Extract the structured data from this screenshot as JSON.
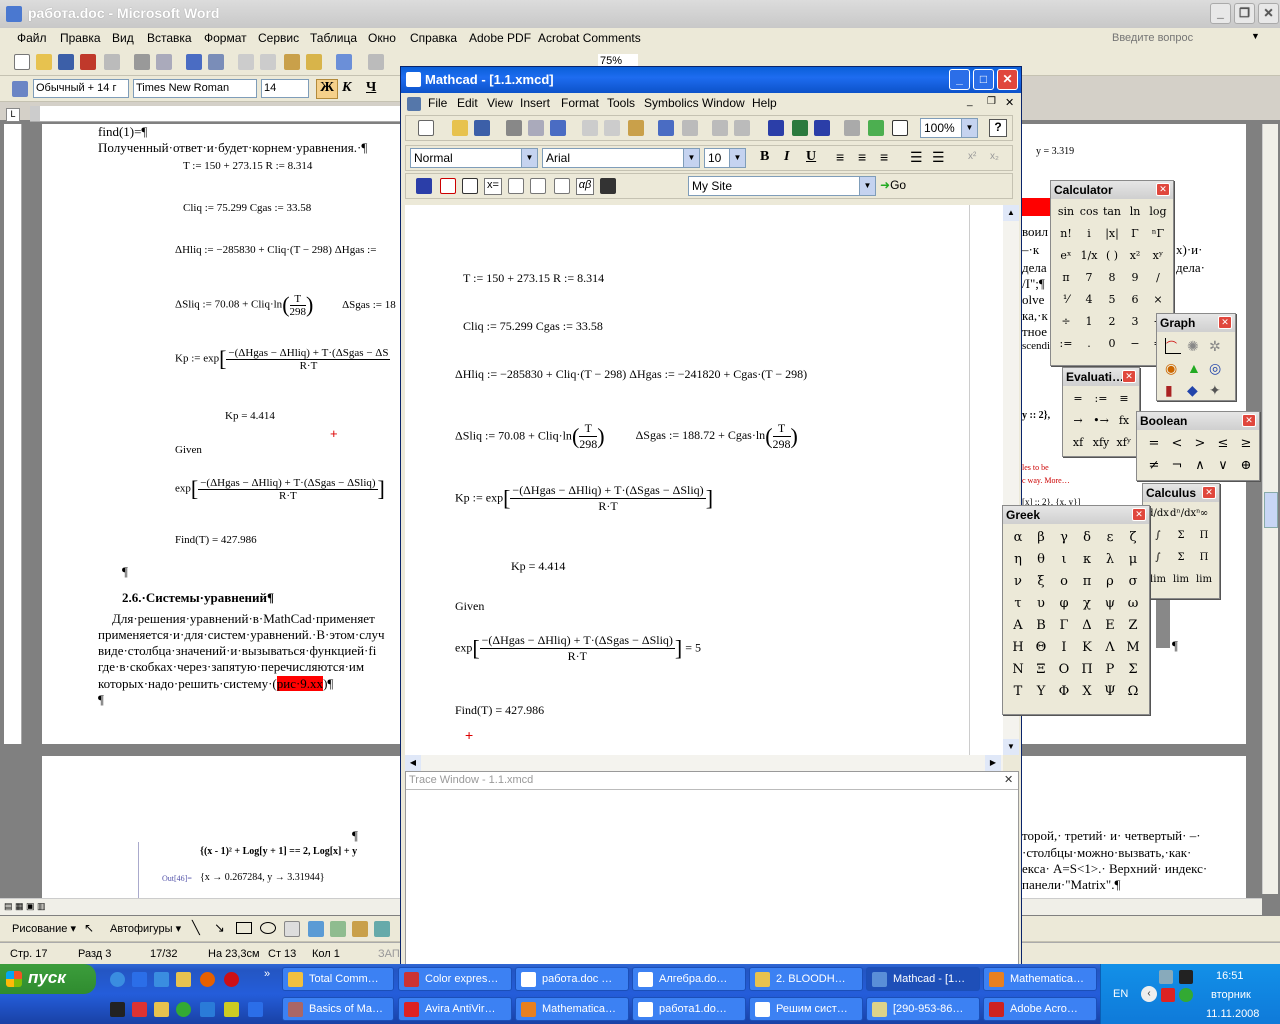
{
  "word": {
    "title": "работа.doc - Microsoft Word",
    "menu": [
      "Файл",
      "Правка",
      "Вид",
      "Вставка",
      "Формат",
      "Сервис",
      "Таблица",
      "Окно",
      "Справка",
      "Adobe PDF",
      "Acrobat Comments"
    ],
    "help_placeholder": "Введите вопрос",
    "style": "Обычный + 14 г",
    "font": "Times New Roman",
    "size": "14",
    "zoom": "75%",
    "bold": "Ж",
    "italic": "К",
    "underline": "Ч",
    "doc_lines": {
      "l1": "find(1)=¶",
      "l2": "Полученный·ответ·и·будет·корнем·уравнения.·¶",
      "heading": "2.6.·Системы·уравнений¶",
      "p1": "Для·решения·уравнений·в·MathCad·применяет",
      "p2": "применяется·и·для·систем·уравнений.·В·этом·случ",
      "p3": "виде·столбца·значений·и·вызываться·функцией·fi",
      "p4": "где·в·скобках·через·запятую·перечисляются·им",
      "p5a": "которых·надо·решить·систему·(",
      "p5b": "рис·9.xx",
      "p5c": ")¶",
      "pil": "¶"
    },
    "doc_eq": {
      "e1": "T := 150 + 273.15        R := 8.314",
      "e2": "Cliq := 75.299              Cgas := 33.58",
      "e3": "ΔHliq := −285830 + Cliq·(T − 298)       ΔHgas :=",
      "e4": "ΔSliq := 70.08 + Cliq·ln",
      "e4b": "ΔSgas := 18",
      "e5": "Kp := exp",
      "e5n": "−(ΔHgas − ΔHliq) + T·(ΔSgas − ΔS",
      "e5d": "R·T",
      "e6": "Kp = 4.414",
      "e7": "Given",
      "e8": "exp",
      "e8n": "−(ΔHgas − ΔHliq) + T·(ΔSgas − ΔSliq)",
      "e8d": "R·T",
      "e9": "Find(T) = 427.986",
      "frac_n": "T",
      "frac_d": "298"
    },
    "right_page": {
      "y_val": "y = 3.319",
      "r1": "воил",
      "r2": "–·к",
      "r3": "дела",
      "r4": "/I\";¶",
      "r5": "olve",
      "r6": "ка,·к",
      "r7": "тное",
      "r8": "scendi",
      "r9": "x)·и·",
      "r10": "дела·",
      "r11": "y :: 2},",
      "r12": "les to be",
      "r13": "c way. More…",
      "r14": "[x] :: 2}, {x, y}]",
      "r15": "¶"
    },
    "page2": {
      "pil": "¶",
      "eq": "{(x - 1)² + Log[y + 1] == 2, Log[x] + y",
      "out_label": "Out[46]=",
      "out": "{x → 0.267284, y → 3.31944}",
      "r1": "торой,· третий· и· четвертый· –·",
      "r2": "·столбцы·можно·вызвать,·как·",
      "r3": "екса· A=S<1>.· Верхний· индекс·",
      "r4": "панели·\"Matrix\".¶"
    },
    "draw_bar": {
      "draw": "Рисование ▾",
      "autoshapes": "Автофигуры ▾"
    },
    "status": {
      "page": "Стр. 17",
      "section": "Разд 3",
      "pages": "17/32",
      "at": "На 23,3см",
      "line": "Ст 13",
      "col": "Кол 1",
      "zap": "ЗАП"
    }
  },
  "mathcad": {
    "title": "Mathcad - [1.1.xmcd]",
    "menu": [
      "File",
      "Edit",
      "View",
      "Insert",
      "Format",
      "Tools",
      "Symbolics",
      "Window",
      "Help"
    ],
    "zoom": "100%",
    "style": "Normal",
    "font": "Arial",
    "size": "10",
    "site": "My Site",
    "go": "Go",
    "b": "B",
    "i": "I",
    "u": "U",
    "eq": {
      "e1": "T := 150 + 273.15        R := 8.314",
      "e2": "Cliq := 75.299                Cgas := 33.58",
      "e3": "ΔHliq := −285830 + Cliq·(T − 298)        ΔHgas := −241820 + Cgas·(T − 298)",
      "e4a": "ΔSliq := 70.08 + Cliq·ln",
      "e4b": "ΔSgas := 188.72 + Cgas·ln",
      "frac_n": "T",
      "frac_d": "298",
      "e5": "Kp := exp",
      "num": "−(ΔHgas − ΔHliq) + T·(ΔSgas − ΔSliq)",
      "den": "R·T",
      "e6": "Kp = 4.414",
      "e7": "Given",
      "e8": "exp",
      "e8r": "= 5",
      "e9": "Find(T) = 427.986"
    },
    "trace_title": "Trace Window - 1.1.xmcd"
  },
  "palettes": {
    "calculator": {
      "title": "Calculator",
      "keys": [
        "sin",
        "cos",
        "tan",
        "ln",
        "log",
        "n!",
        "i",
        "|x|",
        "Γ",
        "ⁿΓ",
        "eˣ",
        "1/x",
        "( )",
        "x²",
        "xʸ",
        "π",
        "7",
        "8",
        "9",
        "/",
        "⅟",
        "4",
        "5",
        "6",
        "×",
        "÷",
        "1",
        "2",
        "3",
        "+",
        ":=",
        ".",
        "0",
        "−",
        "="
      ]
    },
    "graph": {
      "title": "Graph"
    },
    "evaluation": {
      "title": "Evaluati…",
      "keys": [
        "=",
        ":=",
        "≡",
        "→",
        "•→",
        "fx",
        "xf",
        "xfy",
        "xfʸ"
      ]
    },
    "boolean": {
      "title": "Boolean",
      "keys": [
        "=",
        "<",
        ">",
        "≤",
        "≥",
        "≠",
        "¬",
        "∧",
        "∨",
        "⊕"
      ]
    },
    "calculus": {
      "title": "Calculus",
      "keys": [
        "d/dx",
        "dⁿ/dxⁿ",
        "∞",
        "∫",
        "Σ",
        "Π",
        "∫",
        "Σ",
        "Π",
        "lim",
        "lim",
        "lim"
      ]
    },
    "greek": {
      "title": "Greek",
      "keys": [
        "α",
        "β",
        "γ",
        "δ",
        "ε",
        "ζ",
        "η",
        "θ",
        "ι",
        "κ",
        "λ",
        "μ",
        "ν",
        "ξ",
        "ο",
        "π",
        "ρ",
        "σ",
        "τ",
        "υ",
        "φ",
        "χ",
        "ψ",
        "ω",
        "Α",
        "Β",
        "Γ",
        "Δ",
        "Ε",
        "Ζ",
        "Η",
        "Θ",
        "Ι",
        "Κ",
        "Λ",
        "Μ",
        "Ν",
        "Ξ",
        "Ο",
        "Π",
        "Ρ",
        "Σ",
        "Τ",
        "Υ",
        "Φ",
        "Χ",
        "Ψ",
        "Ω"
      ]
    }
  },
  "taskbar": {
    "start": "пуск",
    "row1": [
      "Total Comm…",
      "Color expres…",
      "работа.doc …",
      "Алгебра.do…",
      "2. BLOODH…",
      "Mathcad - [1…",
      "Mathematica…"
    ],
    "row2": [
      "Basics of Ma…",
      "Avira AntiVir…",
      "Mathematica…",
      "работа1.do…",
      "Решим сист…",
      "[290-953-86…",
      "Adobe Acro…"
    ],
    "lang": "EN",
    "time": "16:51",
    "day": "вторник",
    "date": "11.11.2008"
  }
}
